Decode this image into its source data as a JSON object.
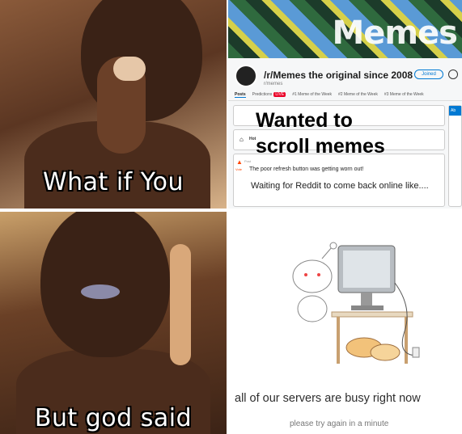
{
  "top_left": {
    "caption": "What if You"
  },
  "bottom_left": {
    "caption": "But god said"
  },
  "reddit": {
    "banner_title": "Memes",
    "subreddit_title": "/r/Memes the original since 2008",
    "subreddit_handle": "r/memes",
    "join_label": "Joined",
    "tabs": [
      "Posts",
      "Predictions",
      "#1 Meme of the Week",
      "#2 Meme of the Week",
      "#3 Meme of the Week"
    ],
    "live_badge": "LIVE",
    "sort_label": "Hot",
    "overlay_line1": "Wanted to",
    "overlay_line2": "scroll memes",
    "post_meta": "Post",
    "vote_label": "Vote",
    "post_title": "The poor refresh button was getting worn out!",
    "waiting_text": "Waiting for Reddit to come back online like....",
    "sidebar_header": "Ab"
  },
  "server_busy": {
    "main_text": "all of our servers are busy right now",
    "sub_text": "please try again in a minute"
  }
}
